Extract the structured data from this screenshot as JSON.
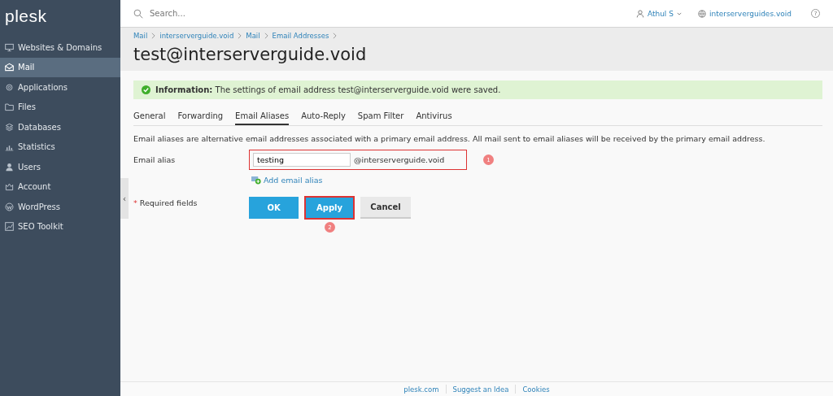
{
  "sidebar": {
    "logo": "plesk",
    "items": [
      {
        "label": "Websites & Domains",
        "selected": false
      },
      {
        "label": "Mail",
        "selected": true
      },
      {
        "label": "Applications",
        "selected": false
      },
      {
        "label": "Files",
        "selected": false
      },
      {
        "label": "Databases",
        "selected": false
      },
      {
        "label": "Statistics",
        "selected": false
      },
      {
        "label": "Users",
        "selected": false
      },
      {
        "label": "Account",
        "selected": false
      },
      {
        "label": "WordPress",
        "selected": false
      },
      {
        "label": "SEO Toolkit",
        "selected": false
      }
    ],
    "collapse": "‹"
  },
  "topbar": {
    "search_placeholder": "Search...",
    "user": "Athul S",
    "domain": "interserverguides.void",
    "help": "?"
  },
  "breadcrumbs": [
    "Mail",
    "interserverguide.void",
    "Mail",
    "Email Addresses"
  ],
  "title": "test@interserverguide.void",
  "message": {
    "text": "**Information:** The settings of email address test@interserverguide.void were saved."
  },
  "tabs": [
    {
      "label": "General",
      "selected": false
    },
    {
      "label": "Forwarding",
      "selected": false
    },
    {
      "label": "Email Aliases",
      "selected": true
    },
    {
      "label": "Auto-Reply",
      "selected": false
    },
    {
      "label": "Spam Filter",
      "selected": false
    },
    {
      "label": "Antivirus",
      "selected": false
    }
  ],
  "description": "Email aliases are alternative email addresses associated with a primary email address. All mail sent to email aliases will be received by the primary email address.",
  "form": {
    "label": "Email alias",
    "value": "testing",
    "suffix": "@interserverguide.void",
    "add_link": "Add email alias",
    "required_note": "Required fields",
    "required_mark": "*"
  },
  "buttons": [
    {
      "label": "OK",
      "kind": "primary",
      "highlighted": false
    },
    {
      "label": "Apply",
      "kind": "primary",
      "highlighted": true
    },
    {
      "label": "Cancel",
      "kind": "secondary",
      "highlighted": false
    }
  ],
  "steps": [
    "1",
    "2"
  ],
  "footer": [
    "plesk.com",
    "Suggest an Idea",
    "Cookies"
  ]
}
